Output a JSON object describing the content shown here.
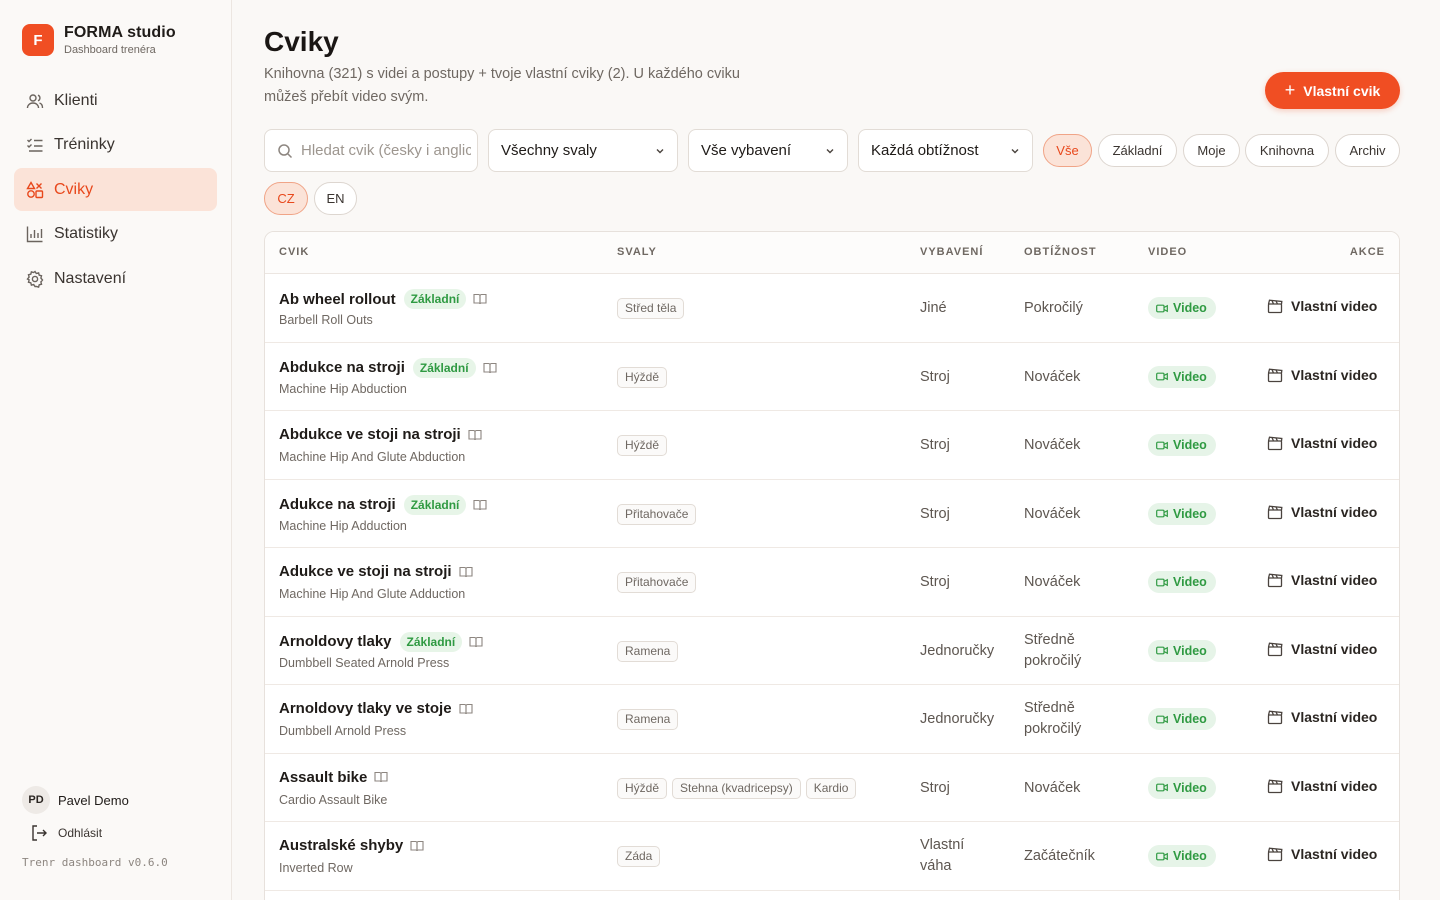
{
  "brand": {
    "logo_letter": "F",
    "name": "FORMA studio",
    "subtitle": "Dashboard trenéra"
  },
  "nav": [
    {
      "label": "Klienti",
      "icon": "users-icon"
    },
    {
      "label": "Tréninky",
      "icon": "checklist-icon"
    },
    {
      "label": "Cviky",
      "icon": "shapes-icon",
      "active": true
    },
    {
      "label": "Statistiky",
      "icon": "bar-chart-icon"
    },
    {
      "label": "Nastavení",
      "icon": "gear-icon"
    }
  ],
  "user": {
    "initials": "PD",
    "name": "Pavel Demo",
    "logout": "Odhlásit",
    "version": "Trenr dashboard v0.6.0"
  },
  "page": {
    "title": "Cviky",
    "subtitle": "Knihovna (321) s videi a postupy + tvoje vlastní cviky (2). U každého cviku můžeš přebít video svým.",
    "add_button": "Vlastní cvik"
  },
  "filters": {
    "search_placeholder": "Hledat cvik (česky i anglicky)",
    "muscles": "Všechny svaly",
    "equipment": "Vše vybavení",
    "difficulty": "Každá obtížnost",
    "source_pills": [
      "Vše",
      "Základní",
      "Moje",
      "Knihovna",
      "Archiv"
    ],
    "lang_pills": [
      "CZ",
      "EN"
    ]
  },
  "table": {
    "headers": [
      "CVIK",
      "SVALY",
      "VYBAVENÍ",
      "OBTÍŽNOST",
      "VIDEO",
      "AKCE"
    ],
    "basic_tag": "Základní",
    "video_label": "Video",
    "action_label": "Vlastní video",
    "rows": [
      {
        "name": "Ab wheel rollout",
        "basic": true,
        "en": "Barbell Roll Outs",
        "muscles": [
          "Střed těla"
        ],
        "equipment": "Jiné",
        "difficulty": "Pokročilý"
      },
      {
        "name": "Abdukce na stroji",
        "basic": true,
        "en": "Machine Hip Abduction",
        "muscles": [
          "Hýždě"
        ],
        "equipment": "Stroj",
        "difficulty": "Nováček"
      },
      {
        "name": "Abdukce ve stoji na stroji",
        "basic": false,
        "en": "Machine Hip And Glute Abduction",
        "muscles": [
          "Hýždě"
        ],
        "equipment": "Stroj",
        "difficulty": "Nováček"
      },
      {
        "name": "Adukce na stroji",
        "basic": true,
        "en": "Machine Hip Adduction",
        "muscles": [
          "Přitahovače"
        ],
        "equipment": "Stroj",
        "difficulty": "Nováček"
      },
      {
        "name": "Adukce ve stoji na stroji",
        "basic": false,
        "en": "Machine Hip And Glute Adduction",
        "muscles": [
          "Přitahovače"
        ],
        "equipment": "Stroj",
        "difficulty": "Nováček"
      },
      {
        "name": "Arnoldovy tlaky",
        "basic": true,
        "en": "Dumbbell Seated Arnold Press",
        "muscles": [
          "Ramena"
        ],
        "equipment": "Jednoručky",
        "difficulty": "Středně pokročilý"
      },
      {
        "name": "Arnoldovy tlaky ve stoje",
        "basic": false,
        "en": "Dumbbell Arnold Press",
        "muscles": [
          "Ramena"
        ],
        "equipment": "Jednoručky",
        "difficulty": "Středně pokročilý"
      },
      {
        "name": "Assault bike",
        "basic": false,
        "en": "Cardio Assault Bike",
        "muscles": [
          "Hýždě",
          "Stehna (kvadricepsy)",
          "Kardio"
        ],
        "equipment": "Stroj",
        "difficulty": "Nováček"
      },
      {
        "name": "Australské shyby",
        "basic": false,
        "en": "Inverted Row",
        "muscles": [
          "Záda"
        ],
        "equipment": "Vlastní váha",
        "difficulty": "Začátečník"
      }
    ]
  },
  "colors": {
    "accent": "#f04e23",
    "accent_soft": "#fbe3d8",
    "success": "#2f9a42",
    "success_soft": "#e6f4e8"
  }
}
